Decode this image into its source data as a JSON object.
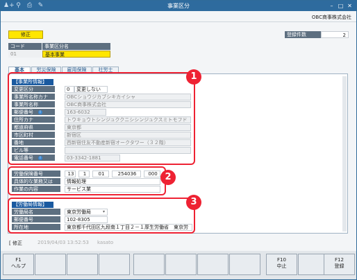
{
  "window": {
    "title": "事業区分",
    "company": "OBC商事株式会社"
  },
  "toolbar": {
    "icons": [
      "person-add-icon",
      "search-icon",
      "print-icon",
      "edit-icon"
    ]
  },
  "badge": {
    "mode": "修正"
  },
  "count": {
    "label": "登録件数",
    "value": "2"
  },
  "header": {
    "code_label": "コード",
    "name_label": "事業区分名",
    "code": "01",
    "name": "基本事業"
  },
  "tabs": [
    "基本",
    "労災保険",
    "雇用保険",
    "社労士"
  ],
  "section1": {
    "title": "【事業所情報】",
    "rows": [
      {
        "label": "変更区分",
        "value": "0",
        "value2": "変更しない"
      },
      {
        "label": "事業所名称カナ",
        "value": "OBCショウジカブシキカイシャ"
      },
      {
        "label": "事業所名称",
        "value": "OBC商事株式会社"
      },
      {
        "label": "郵便番号",
        "value": "163-6032"
      },
      {
        "label": "住所カナ",
        "value": "トウキョウトシンジュククニシシンジュクスミトモフド"
      },
      {
        "label": "都道府県",
        "value": "東京都"
      },
      {
        "label": "市区町村",
        "value": "新宿区"
      },
      {
        "label": "番地",
        "value": "西新宿住友不動産新宿オークタワー（３２階）"
      },
      {
        "label": "ビル等",
        "value": ""
      },
      {
        "label": "電話番号",
        "value": "03-3342-1881"
      }
    ]
  },
  "section2": {
    "rows": [
      {
        "label": "労働保険番号",
        "parts": [
          "13",
          "1",
          "01",
          "254036",
          "000"
        ]
      },
      {
        "label": "具体的な業務又は",
        "value": "情報処理"
      },
      {
        "label": "作業の内容",
        "value": "サービス業"
      }
    ]
  },
  "section3": {
    "title": "【労働局情報】",
    "rows": [
      {
        "label": "労働局名",
        "value": "東京労働局"
      },
      {
        "label": "郵便番号",
        "value": "102-8305"
      },
      {
        "label": "所在地",
        "value": "東京都千代田区九段南１丁目２－１厚生労働省　東京労"
      }
    ]
  },
  "callouts": [
    "1",
    "2",
    "3"
  ],
  "footer": {
    "status": "[ 修正",
    "timestamp": "2019/04/03 13:52:53",
    "user": "kasato"
  },
  "fkeys": [
    {
      "key": "F1",
      "label": "ヘルプ"
    },
    {
      "key": "",
      "label": ""
    },
    {
      "key": "",
      "label": ""
    },
    {
      "key": "",
      "label": ""
    },
    {
      "key": "",
      "label": ""
    },
    {
      "key": "",
      "label": ""
    },
    {
      "key": "",
      "label": ""
    },
    {
      "key": "",
      "label": ""
    },
    {
      "key": "",
      "label": ""
    },
    {
      "key": "F10",
      "label": "中止"
    },
    {
      "key": "",
      "label": ""
    },
    {
      "key": "F12",
      "label": "登録"
    }
  ],
  "colors": {
    "titlebar": "#2e6b9e",
    "accent_red": "#e22233",
    "badge_yellow": "#ffe600",
    "label_gray": "#5d6f80",
    "section_blue": "#1a5aa0"
  }
}
